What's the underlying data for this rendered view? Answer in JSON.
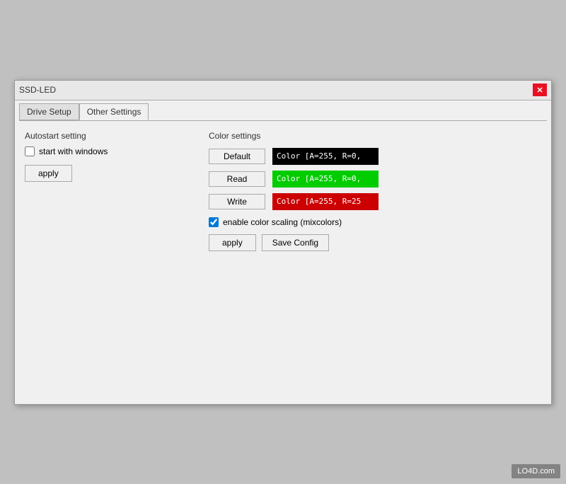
{
  "window": {
    "title": "SSD-LED",
    "close_label": "✕"
  },
  "tabs": [
    {
      "label": "Drive Setup",
      "active": false
    },
    {
      "label": "Other Settings",
      "active": true
    }
  ],
  "left_panel": {
    "section_title": "Autostart setting",
    "checkbox_label": "start with windows",
    "checkbox_checked": false,
    "apply_label": "apply"
  },
  "right_panel": {
    "section_title": "Color settings",
    "default_btn": "Default",
    "read_btn": "Read",
    "write_btn": "Write",
    "default_color_text": "Color [A=255, R=0,",
    "read_color_text": "Color [A=255, R=0,",
    "write_color_text": "Color [A=255, R=25",
    "enable_scaling_label": "enable color scaling (mixcolors)",
    "enable_scaling_checked": true,
    "apply_label": "apply",
    "save_config_label": "Save Config"
  },
  "watermark": "LO4D.com"
}
